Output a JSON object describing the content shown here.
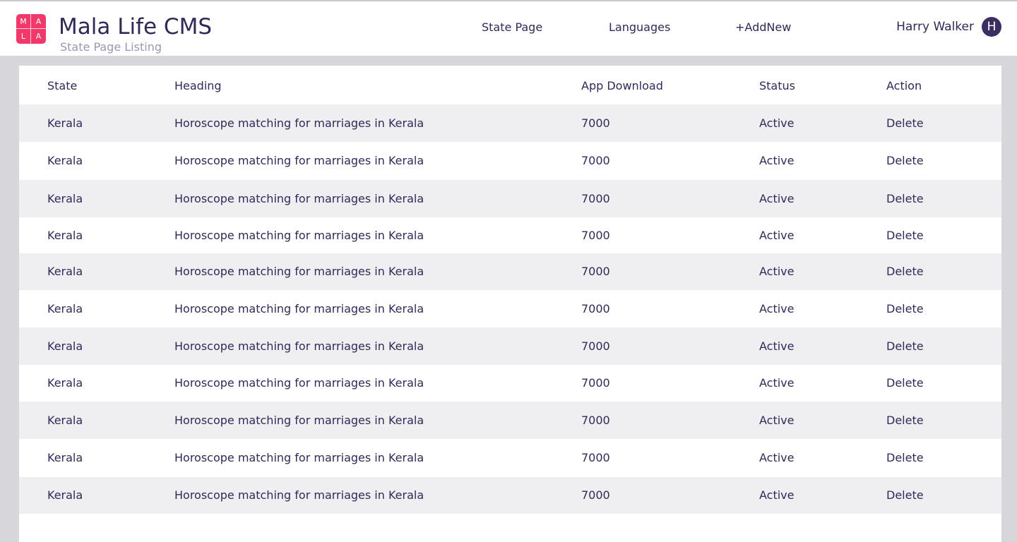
{
  "app": {
    "logo_letters": [
      "M",
      "A",
      "L",
      "A"
    ],
    "logo_color": "#f0386b",
    "title": "Mala Life CMS",
    "subtitle": "State Page Listing"
  },
  "nav": {
    "items": [
      {
        "label": "State Page"
      },
      {
        "label": "Languages"
      },
      {
        "label": "+AddNew"
      }
    ]
  },
  "user": {
    "name": "Harry Walker",
    "initial": "H"
  },
  "table": {
    "columns": [
      "State",
      "Heading",
      "App Download",
      "Status",
      "Action"
    ],
    "rows": [
      {
        "state": "Kerala",
        "heading": "Horoscope matching for marriages in Kerala",
        "downloads": "7000",
        "status": "Active",
        "action": "Delete"
      },
      {
        "state": "Kerala",
        "heading": "Horoscope matching for marriages in Kerala",
        "downloads": "7000",
        "status": "Active",
        "action": "Delete"
      },
      {
        "state": "Kerala",
        "heading": "Horoscope matching for marriages in Kerala",
        "downloads": "7000",
        "status": "Active",
        "action": "Delete"
      },
      {
        "state": "Kerala",
        "heading": "Horoscope matching for marriages in Kerala",
        "downloads": "7000",
        "status": "Active",
        "action": "Delete"
      },
      {
        "state": "Kerala",
        "heading": "Horoscope matching for marriages in Kerala",
        "downloads": "7000",
        "status": "Active",
        "action": "Delete"
      },
      {
        "state": "Kerala",
        "heading": "Horoscope matching for marriages in Kerala",
        "downloads": "7000",
        "status": "Active",
        "action": "Delete"
      },
      {
        "state": "Kerala",
        "heading": "Horoscope matching for marriages in Kerala",
        "downloads": "7000",
        "status": "Active",
        "action": "Delete"
      },
      {
        "state": "Kerala",
        "heading": "Horoscope matching for marriages in Kerala",
        "downloads": "7000",
        "status": "Active",
        "action": "Delete"
      },
      {
        "state": "Kerala",
        "heading": "Horoscope matching for marriages in Kerala",
        "downloads": "7000",
        "status": "Active",
        "action": "Delete"
      },
      {
        "state": "Kerala",
        "heading": "Horoscope matching for marriages in Kerala",
        "downloads": "7000",
        "status": "Active",
        "action": "Delete"
      },
      {
        "state": "Kerala",
        "heading": "Horoscope matching for marriages in Kerala",
        "downloads": "7000",
        "status": "Active",
        "action": "Delete"
      }
    ]
  }
}
